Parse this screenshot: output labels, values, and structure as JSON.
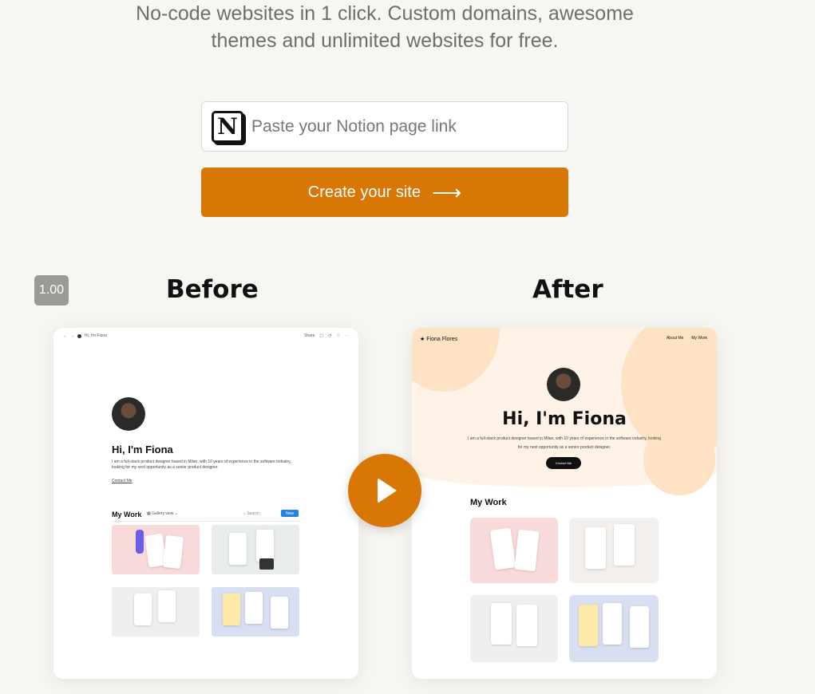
{
  "hero": {
    "tagline_line1": "No-code websites in 1 click. Custom domains, awesome",
    "tagline_line2": "themes and unlimited websites for free."
  },
  "form": {
    "placeholder": "Paste your Notion page link",
    "logo_letter": "N",
    "button_label": "Create your site",
    "button_icon": "arrow-right-icon"
  },
  "zoom_badge": "1.00",
  "comparison": {
    "before_title": "Before",
    "after_title": "After",
    "play_icon": "play-icon",
    "before": {
      "breadcrumb": "Hi, I'm Fiona",
      "share": "Share",
      "name": "Hi, I'm Fiona",
      "description": "I am a full-stack product designer based in Milan, with 10 years of experience in the software industry, looking for my next opportunity as a senior product designer.",
      "contact": "Contact Me",
      "section": "My Work",
      "view": "Gallery view",
      "search": "Search",
      "new": "New"
    },
    "after": {
      "brand": "Fiona Flores",
      "nav": [
        "About Me",
        "My Work"
      ],
      "name": "Hi, I'm Fiona",
      "description": "I am a full-stack product designer based in Milan, with 10 years of experience in the software industry, looking for my next opportunity as a senior product designer.",
      "contact": "Contact Me",
      "section": "My Work"
    }
  },
  "colors": {
    "accent": "#d97706",
    "background": "#f7f6f3",
    "hero_peach": "#fef3e6"
  }
}
